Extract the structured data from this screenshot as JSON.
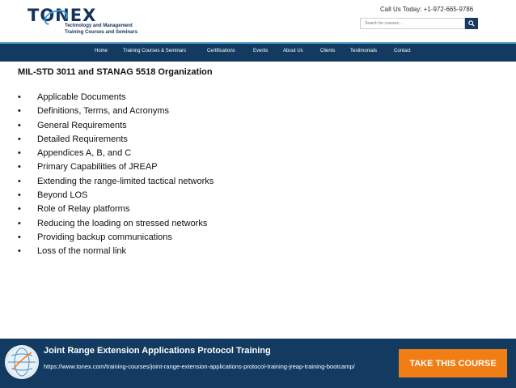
{
  "header": {
    "logo_text": "TONEX",
    "logo_tagline_1": "Technology and Management",
    "logo_tagline_2": "Training Courses and Seminars",
    "call_text": "Call Us Today: +1-972-665-9786",
    "search_placeholder": "Search for courses...",
    "search_icon": "search-icon"
  },
  "nav": {
    "items": [
      {
        "label": "Home"
      },
      {
        "label": "Training Courses & Seminars"
      },
      {
        "label": "Certifications"
      },
      {
        "label": "Events"
      },
      {
        "label": "About Us"
      },
      {
        "label": "Clients"
      },
      {
        "label": "Testimonials"
      },
      {
        "label": "Contact"
      }
    ]
  },
  "content": {
    "title": "MIL-STD 3011 and STANAG 5518 Organization",
    "bullet_glyph": "•",
    "items": [
      "Applicable Documents",
      "Definitions, Terms, and Acronyms",
      "General Requirements",
      "Detailed Requirements",
      "Appendices A, B, and C",
      "Primary Capabilities of JREAP",
      "Extending the range-limited tactical networks",
      "Beyond LOS",
      "Role of Relay platforms",
      "Reducing the loading on stressed networks",
      "Providing backup communications",
      "Loss of the normal link"
    ]
  },
  "banner": {
    "title": "Joint Range Extension Applications Protocol Training",
    "link": "https://www.tonex.com/training-courses/joint-range-extension-applications-protocol-training-jreap-training-bootcamp/",
    "cta_label": "TAKE THIS COURSE"
  },
  "colors": {
    "navy": "#133b62",
    "accent_blue": "#5a9ed0",
    "cta_orange": "#f07e14"
  }
}
